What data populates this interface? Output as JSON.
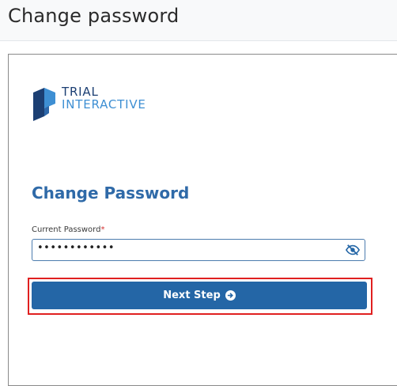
{
  "header": {
    "title": "Change password"
  },
  "logo": {
    "line1": "TRIAL",
    "line2": "INTERACTIVE"
  },
  "form": {
    "title": "Change Password",
    "current_password_label": "Current Password",
    "required_mark": "*",
    "current_password_value": "••••••••••••",
    "visibility_icon": "eye-slash-icon",
    "next_button_label": "Next Step",
    "next_button_icon": "arrow-circle-right-icon"
  },
  "colors": {
    "primary": "#2466a6",
    "title": "#2f6aa8",
    "highlight": "#e02020",
    "logo_dark": "#1c3f73",
    "logo_light": "#3e8fd3"
  }
}
